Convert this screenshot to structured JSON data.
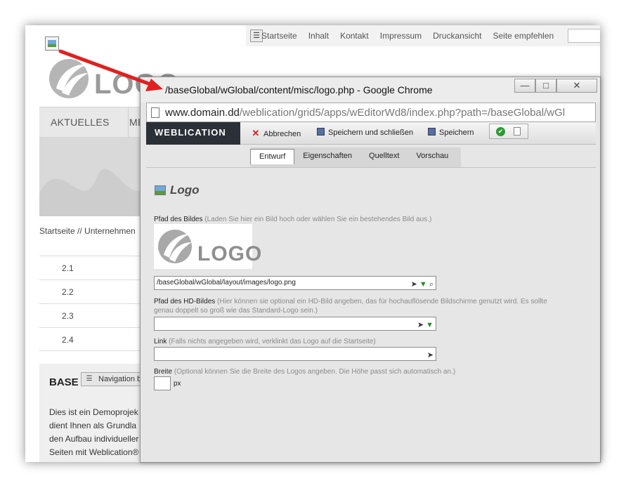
{
  "background_page": {
    "top_nav": {
      "items": [
        "Startseite",
        "Inhalt",
        "Kontakt",
        "Impressum",
        "Druckansicht",
        "Seite empfehlen"
      ]
    },
    "logo_text": "LOGO",
    "main_nav": {
      "items": [
        "AKTUELLES",
        "ME"
      ]
    },
    "breadcrumb": "Startseite // Unternehmen",
    "list_items": [
      "2.1",
      "2.2",
      "2.3",
      "2.4"
    ],
    "box_title": "BASE",
    "box_text": [
      "Dies ist ein Demoprojek",
      "dient Ihnen als Grundla",
      "den Aufbau individueller",
      "Seiten mit Weblication®"
    ],
    "nav_tooltip": "Navigation b"
  },
  "popup": {
    "window_title": "/baseGlobal/wGlobal/content/misc/logo.php - Google Chrome",
    "window_buttons": {
      "minimize": "—",
      "maximize": "□",
      "close": "✕"
    },
    "url_host": "www.domain.dd",
    "url_path": "/weblication/grid5/apps/wEditorWd8/index.php?path=/baseGlobal/wGl",
    "toolbar": {
      "brand": "WEBLICATION",
      "cancel_label": "Abbrechen",
      "save_close_label": "Speichern und schließen",
      "save_label": "Speichern"
    },
    "tabs": [
      "Entwurf",
      "Eigenschaften",
      "Quelltext",
      "Vorschau"
    ],
    "active_tab": "Entwurf",
    "heading": "Logo",
    "image_path": {
      "label": "Pfad des Bildes",
      "hint": "(Laden Sie hier ein Bild hoch oder wählen Sie ein bestehendes Bild aus.)",
      "value": "/baseGlobal/wGlobal/layout/images/logo.png",
      "preview_text": "LOGO"
    },
    "hd_image_path": {
      "label": "Pfad des HD-Bildes",
      "hint_line1": "(Hier können sie optional ein HD-Bild angeben, das für hochauflösende Bildschirme genutzt wird. Es sollte",
      "hint_line2": "genau doppelt so groß wie das Standard-Logo sein.)",
      "value": ""
    },
    "link": {
      "label": "Link",
      "hint": "(Falls nichts angegeben wird, verklinkt das Logo auf die Startseite)",
      "value": ""
    },
    "width": {
      "label": "Breite",
      "hint": "(Optional können Sie die Breite des Logos angeben. Die Höhe passt sich automatisch an.)",
      "value": "",
      "unit": "px"
    }
  },
  "colors": {
    "arrow": "#e02020",
    "brand_bg": "#2b2f38",
    "cancel_icon": "#d42020",
    "ok_icon": "#2f9a34"
  }
}
